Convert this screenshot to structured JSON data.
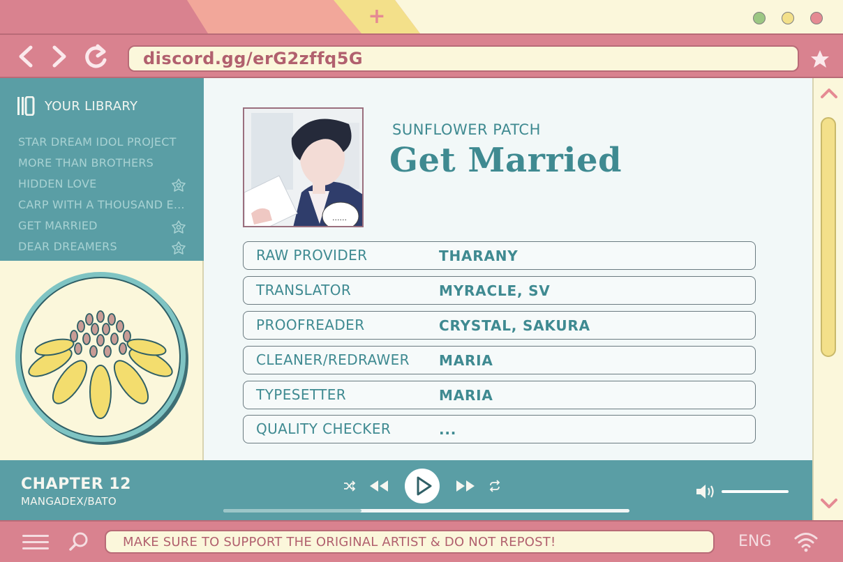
{
  "browser": {
    "url": "discord.gg/erG2zffq5G",
    "window_dots": [
      {
        "name": "green",
        "color": "#9cc783"
      },
      {
        "name": "yellow",
        "color": "#f3e08a"
      },
      {
        "name": "pink",
        "color": "#e58a93"
      }
    ]
  },
  "sidebar": {
    "title": "YOUR LIBRARY",
    "items": [
      {
        "label": "STAR DREAM IDOL PROJECT",
        "has_icon": false
      },
      {
        "label": "MORE THAN BROTHERS",
        "has_icon": false
      },
      {
        "label": "HIDDEN LOVE",
        "has_icon": true
      },
      {
        "label": "CARP WITH A THOUSAND E...",
        "has_icon": false
      },
      {
        "label": "GET MARRIED",
        "has_icon": true
      },
      {
        "label": "DEAR DREAMERS",
        "has_icon": true
      }
    ]
  },
  "main": {
    "group": "SUNFLOWER PATCH",
    "title": "Get Married",
    "cover_speech": "......",
    "credits": [
      {
        "role": "RAW PROVIDER",
        "name": "THARANY"
      },
      {
        "role": "TRANSLATOR",
        "name": "MYRACLE, SV"
      },
      {
        "role": "PROOFREADER",
        "name": "CRYSTAL, SAKURA"
      },
      {
        "role": "CLEANER/REDRAWER",
        "name": "MARIA"
      },
      {
        "role": "TYPESETTER",
        "name": "MARIA"
      },
      {
        "role": "QUALITY CHECKER",
        "name": "..."
      }
    ]
  },
  "player": {
    "chapter": "CHAPTER 12",
    "source": "MANGADEX/BATO",
    "progress": 0.34
  },
  "bottom": {
    "notice": "MAKE SURE TO SUPPORT THE ORIGINAL ARTIST & DO NOT REPOST!",
    "language": "ENG"
  },
  "colors": {
    "frame_pink": "#d9828f",
    "teal": "#5a9ea5",
    "cream": "#fbf7db",
    "text_teal": "#3f8a91"
  }
}
